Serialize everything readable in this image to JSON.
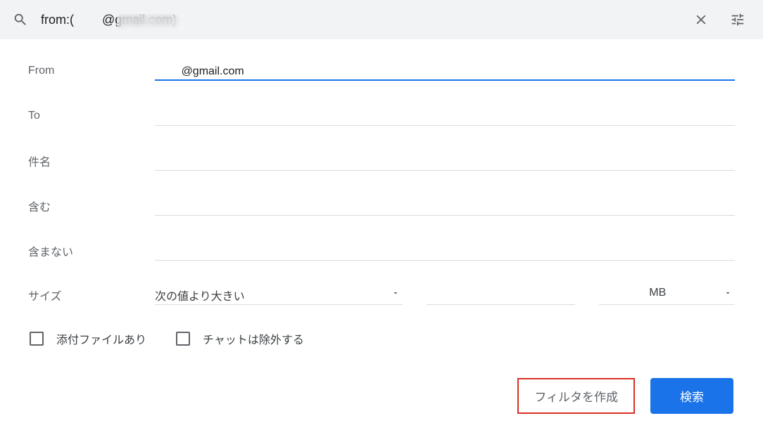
{
  "search": {
    "prefix": "from:(",
    "redacted_placeholder": "        ",
    "suffix": "@gmail.com)"
  },
  "fields": {
    "from": {
      "label": "From",
      "value_prefix": "",
      "value_redacted": "        ",
      "value_suffix": "@gmail.com"
    },
    "to": {
      "label": "To"
    },
    "subject": {
      "label": "件名"
    },
    "contains": {
      "label": "含む"
    },
    "not_contains": {
      "label": "含まない"
    },
    "size": {
      "label": "サイズ",
      "operator_text": "次の値より大きい",
      "unit_text": "MB"
    }
  },
  "checkboxes": {
    "has_attachment": "添付ファイルあり",
    "exclude_chat": "チャットは除外する"
  },
  "buttons": {
    "create_filter": "フィルタを作成",
    "search": "検索"
  }
}
